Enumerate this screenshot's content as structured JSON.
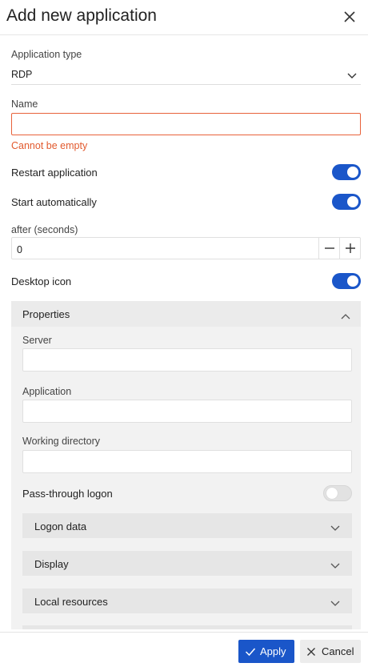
{
  "dialog": {
    "title": "Add new application"
  },
  "form": {
    "app_type_label": "Application type",
    "app_type_value": "RDP",
    "name_label": "Name",
    "name_value": "",
    "name_error": "Cannot be empty",
    "restart_label": "Restart application",
    "restart_on": true,
    "start_auto_label": "Start automatically",
    "start_auto_on": true,
    "after_label": "after (seconds)",
    "after_value": "0",
    "desktop_icon_label": "Desktop icon",
    "desktop_icon_on": true
  },
  "properties": {
    "title": "Properties",
    "server_label": "Server",
    "server_value": "",
    "application_label": "Application",
    "application_value": "",
    "workdir_label": "Working directory",
    "workdir_value": "",
    "passthrough_label": "Pass-through logon",
    "passthrough_on": false,
    "sections": [
      {
        "label": "Logon data"
      },
      {
        "label": "Display"
      },
      {
        "label": "Local resources"
      }
    ]
  },
  "footer": {
    "apply_label": "Apply",
    "cancel_label": "Cancel"
  },
  "colors": {
    "accent": "#1a56c9",
    "error": "#e25a2e"
  }
}
